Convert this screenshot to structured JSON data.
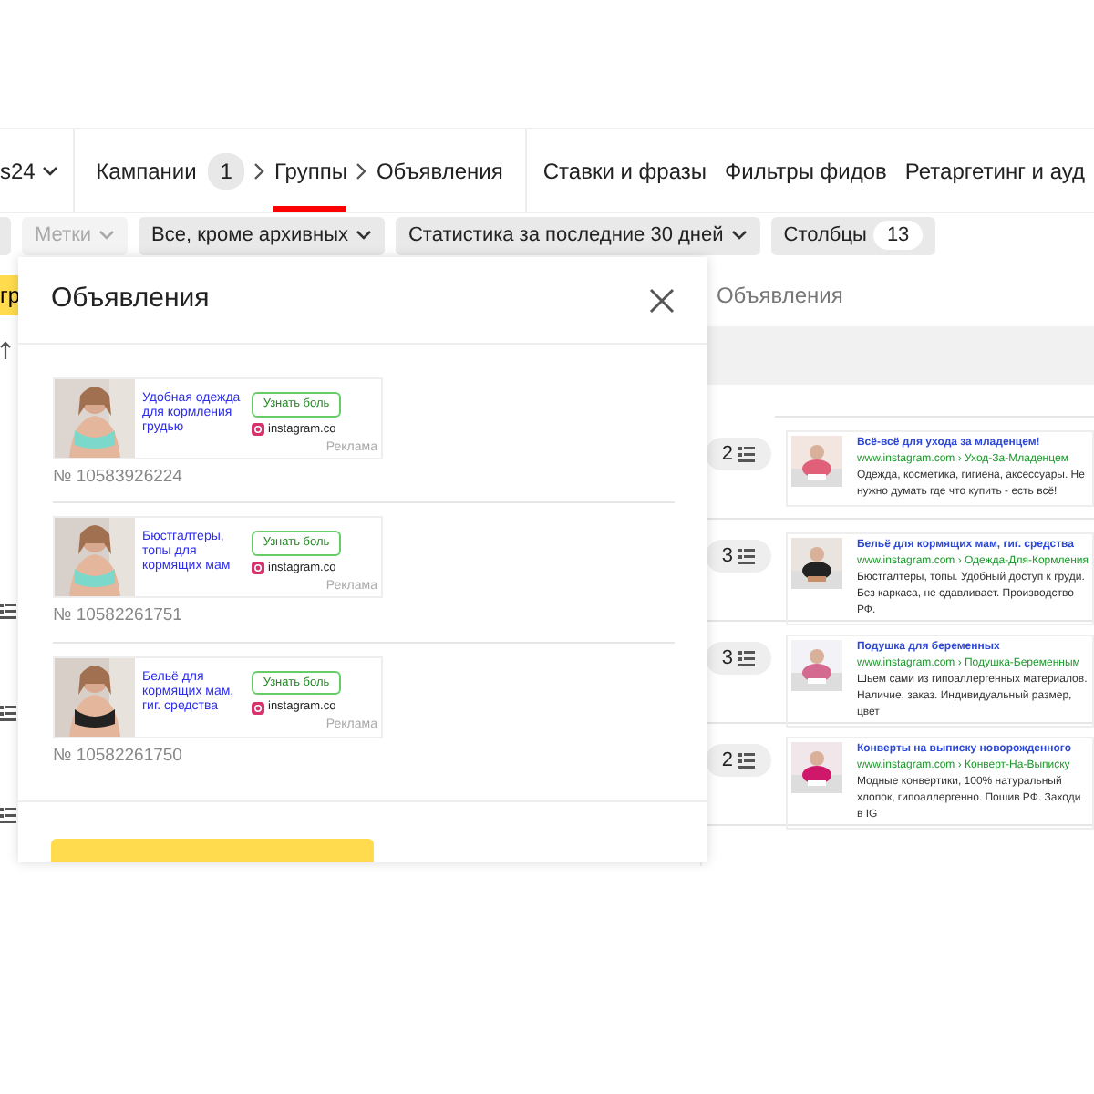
{
  "nav": {
    "account": "s24",
    "crumbs": [
      {
        "label": "Кампании",
        "count": "1",
        "selected": false
      },
      {
        "label": "Группы",
        "selected": true
      },
      {
        "label": "Объявления",
        "selected": false
      }
    ],
    "tabs": [
      "Ставки и фразы",
      "Фильтры фидов",
      "Ретаргетинг и ауд"
    ]
  },
  "filters": [
    {
      "label": "Метки",
      "disabled": true
    },
    {
      "label": "Все, кроме архивных",
      "disabled": false
    },
    {
      "label": "Статистика за последние 30 дней",
      "disabled": false
    },
    {
      "label": "Столбцы",
      "count": "13",
      "disabled": false
    }
  ],
  "side_button": "гр",
  "table": {
    "column": "Объявления",
    "rows": [
      {
        "count": "2",
        "side_icon": false,
        "title": "Всё-всё для ухода за младенцем!",
        "url": "www.instagram.com › Уход-За-Младенцем",
        "text": "Одежда, косметика, гигиена, аксессуары. Не нужно думать где что купить - есть всё!"
      },
      {
        "count": "3",
        "side_icon": true,
        "title": "Бельё для кормящих мам, гиг. средства",
        "url": "www.instagram.com › Одежда-Для-Кормления",
        "text": "Бюстгалтеры, топы. Удобный доступ к груди. Без каркаса, не сдавливает. Производство РФ."
      },
      {
        "count": "3",
        "side_icon": true,
        "title": "Подушка для беременных",
        "url": "www.instagram.com › Подушка-Беременным",
        "text": "Шьем сами из гипоаллергенных материалов. Наличие, заказ. Индивидуальный размер, цвет"
      },
      {
        "count": "2",
        "side_icon": true,
        "title": "Конверты на выписку новорожденного",
        "url": "www.instagram.com › Конверт-На-Выписку",
        "text": "Модные конвертики, 100% натуральный хлопок, гипоаллергенно. Пошив РФ. Заходи в IG"
      }
    ]
  },
  "modal": {
    "title": "Объявления",
    "ads": [
      {
        "title": "Удобная одежда для кормления грудью",
        "button": "Узнать боль",
        "site": "instagram.co",
        "label": "Реклама",
        "number": "№ 10583926224"
      },
      {
        "title": "Бюстгалтеры, топы для кормящих мам",
        "button": "Узнать боль",
        "site": "instagram.co",
        "label": "Реклама",
        "number": "№ 10582261751"
      },
      {
        "title": "Бельё для кормящих мам, гиг. средства",
        "button": "Узнать боль",
        "site": "instagram.co",
        "label": "Реклама",
        "number": "№ 10582261750"
      }
    ]
  }
}
